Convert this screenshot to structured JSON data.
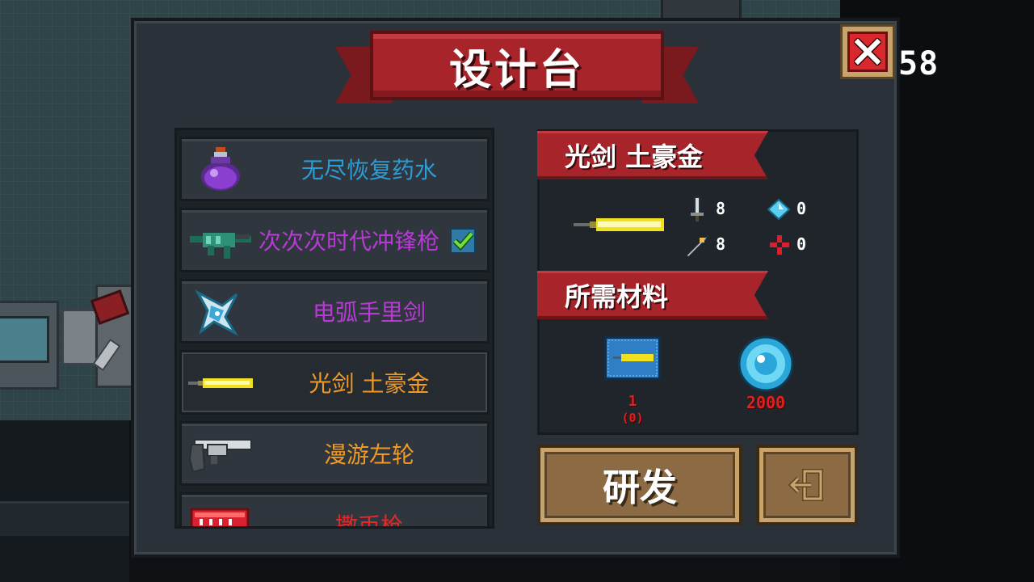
{
  "title": "设计台",
  "hud": {
    "score_fragment": "58"
  },
  "weapons": [
    {
      "name": "无尽恢复药水",
      "color": "#2a9dd8",
      "icon": "potion-icon"
    },
    {
      "name": "次次次时代冲锋枪",
      "color": "#b83ad6",
      "icon": "smg-icon",
      "checked": true
    },
    {
      "name": "电弧手里剑",
      "color": "#b83ad6",
      "icon": "shuriken-icon"
    },
    {
      "name": "光剑 土豪金",
      "color": "#f09a24",
      "icon": "lightsaber-icon",
      "selected": true
    },
    {
      "name": "漫游左轮",
      "color": "#f09a24",
      "icon": "revolver-icon"
    },
    {
      "name": "撒币枪",
      "color": "#e02a2a",
      "icon": "coin-gun-icon"
    }
  ],
  "detail": {
    "name": "光剑 土豪金",
    "stats": {
      "damage": "8",
      "energy": "0",
      "precision": "8",
      "crit": "0"
    },
    "materials_title": "所需材料",
    "materials": [
      {
        "icon": "blueprint-icon",
        "count": "1",
        "owned": "(0)"
      },
      {
        "icon": "gem-icon",
        "count": "2000"
      }
    ]
  },
  "buttons": {
    "research": "研发"
  }
}
